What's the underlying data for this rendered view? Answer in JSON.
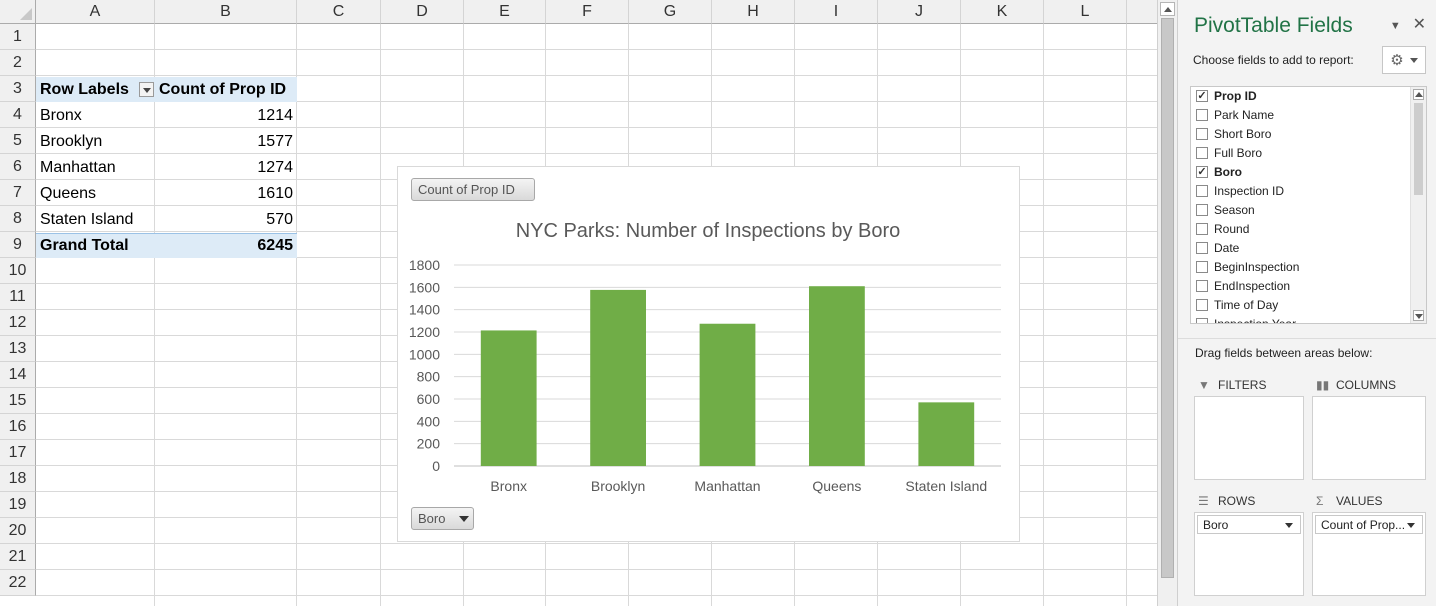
{
  "columns": [
    "A",
    "B",
    "C",
    "D",
    "E",
    "F",
    "G",
    "H",
    "I",
    "J",
    "K",
    "L"
  ],
  "rows": [
    "1",
    "2",
    "3",
    "4",
    "5",
    "6",
    "7",
    "8",
    "9",
    "10",
    "11",
    "12",
    "13",
    "14",
    "15",
    "16",
    "17",
    "18",
    "19",
    "20",
    "21",
    "22"
  ],
  "pivot": {
    "header_label": "Row Labels",
    "header_value": "Count of Prop ID",
    "items": [
      {
        "label": "Bronx",
        "value": "1214"
      },
      {
        "label": "Brooklyn",
        "value": "1577"
      },
      {
        "label": "Manhattan",
        "value": "1274"
      },
      {
        "label": "Queens",
        "value": "1610"
      },
      {
        "label": "Staten Island",
        "value": "570"
      }
    ],
    "total_label": "Grand Total",
    "total_value": "6245"
  },
  "chart": {
    "value_button": "Count of Prop ID",
    "axis_button": "Boro"
  },
  "chart_data": {
    "type": "bar",
    "title": "NYC Parks: Number of Inspections by Boro",
    "categories": [
      "Bronx",
      "Brooklyn",
      "Manhattan",
      "Queens",
      "Staten Island"
    ],
    "values": [
      1214,
      1577,
      1274,
      1610,
      570
    ],
    "ylim": [
      0,
      1800
    ],
    "yticks": [
      "0",
      "200",
      "400",
      "600",
      "800",
      "1000",
      "1200",
      "1400",
      "1600",
      "1800"
    ],
    "grid": true,
    "bar_color": "#70ad47",
    "legend": "none"
  },
  "pane": {
    "title": "PivotTable Fields",
    "subtitle": "Choose fields to add to report:",
    "fields": [
      {
        "name": "Prop ID",
        "checked": true
      },
      {
        "name": "Park Name",
        "checked": false
      },
      {
        "name": "Short Boro",
        "checked": false
      },
      {
        "name": "Full Boro",
        "checked": false
      },
      {
        "name": "Boro",
        "checked": true
      },
      {
        "name": "Inspection ID",
        "checked": false
      },
      {
        "name": "Season",
        "checked": false
      },
      {
        "name": "Round",
        "checked": false
      },
      {
        "name": "Date",
        "checked": false
      },
      {
        "name": "BeginInspection",
        "checked": false
      },
      {
        "name": "EndInspection",
        "checked": false
      },
      {
        "name": "Time of Day",
        "checked": false
      },
      {
        "name": "Inspection Year",
        "checked": false
      }
    ],
    "drag_hint": "Drag fields between areas below:",
    "areas": {
      "filters": "FILTERS",
      "columns": "COLUMNS",
      "rows": "ROWS",
      "values": "VALUES",
      "rows_item": "Boro",
      "values_item": "Count of Prop..."
    }
  }
}
